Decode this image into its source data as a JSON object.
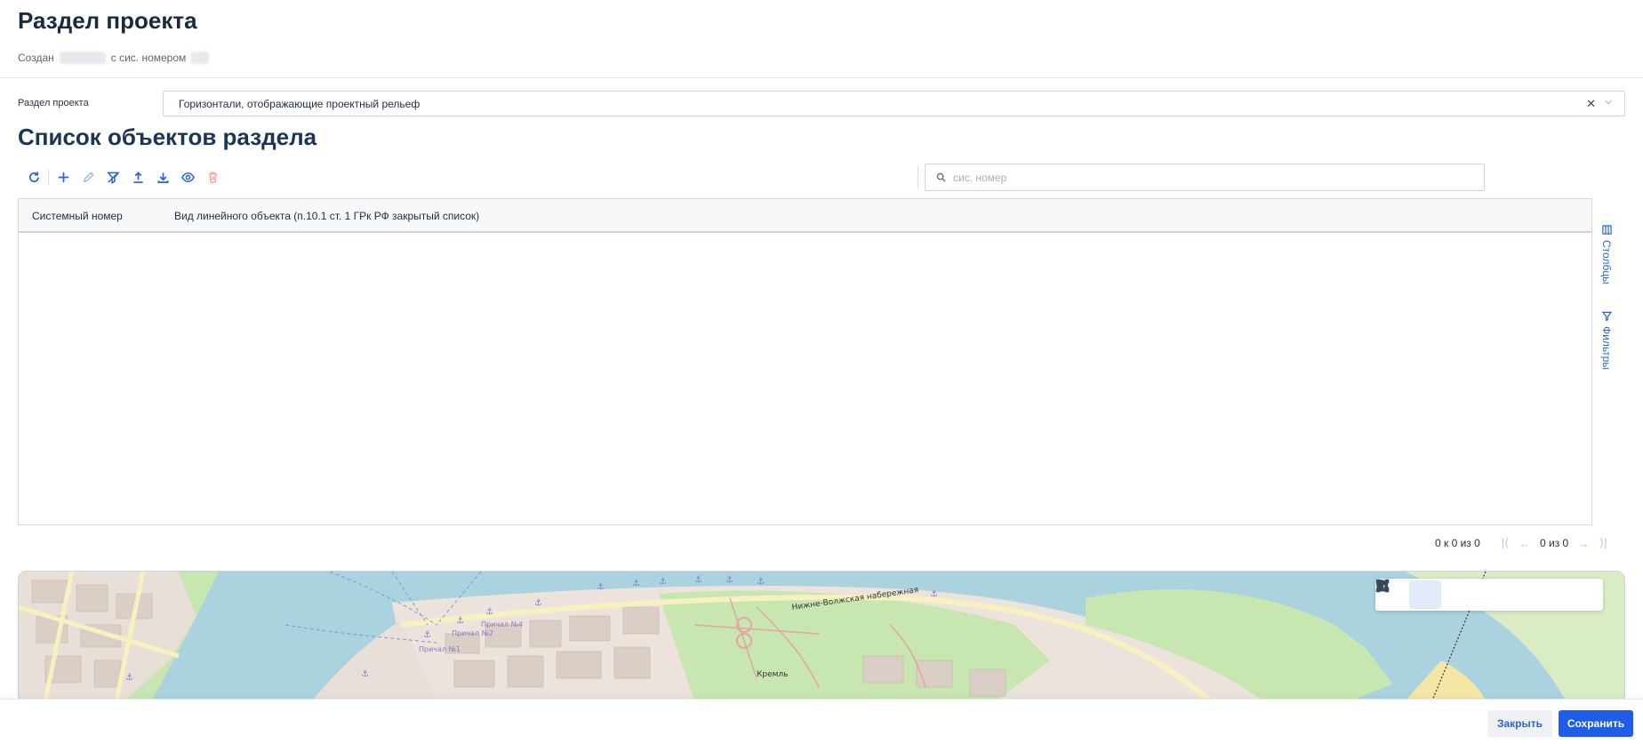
{
  "header": {
    "title": "Раздел проекта",
    "created_prefix": "Создан",
    "sys_number_label": "с сис. номером"
  },
  "form": {
    "field_label": "Раздел проекта",
    "selected_value": "Горизонтали, отображающие проектный рельеф"
  },
  "section": {
    "title": "Список объектов раздела"
  },
  "toolbar": {
    "icons": [
      "refresh-icon",
      "plus-icon",
      "pencil-icon",
      "filter-clear-icon",
      "upload-icon",
      "download-icon",
      "eye-icon",
      "trash-icon"
    ]
  },
  "search": {
    "placeholder": "сис. номер"
  },
  "grid": {
    "columns": [
      "Системный номер",
      "Вид линейного объекта (п.10.1 ст. 1 ГРк РФ закрытый список)"
    ],
    "rows": []
  },
  "side_panel": {
    "columns_label": "Столбцы",
    "filters_label": "Фильтры"
  },
  "pagination": {
    "range_text": "0 к 0 из 0",
    "page_text": "0 из 0"
  },
  "map": {
    "labels": [
      "Нижне-Волжская набережная",
      "Кремль",
      "Причал №1",
      "Причал №2",
      "Причал №4"
    ],
    "tools": [
      "layers-icon",
      "select-area-icon",
      "measure-icon",
      "search-icon",
      "camera-icon",
      "export-icon",
      "fullscreen-icon"
    ]
  },
  "footer": {
    "close_label": "Закрыть",
    "save_label": "Сохранить"
  },
  "colors": {
    "accent": "#1e5de8",
    "title": "#1d3554",
    "water": "#aad3df"
  }
}
